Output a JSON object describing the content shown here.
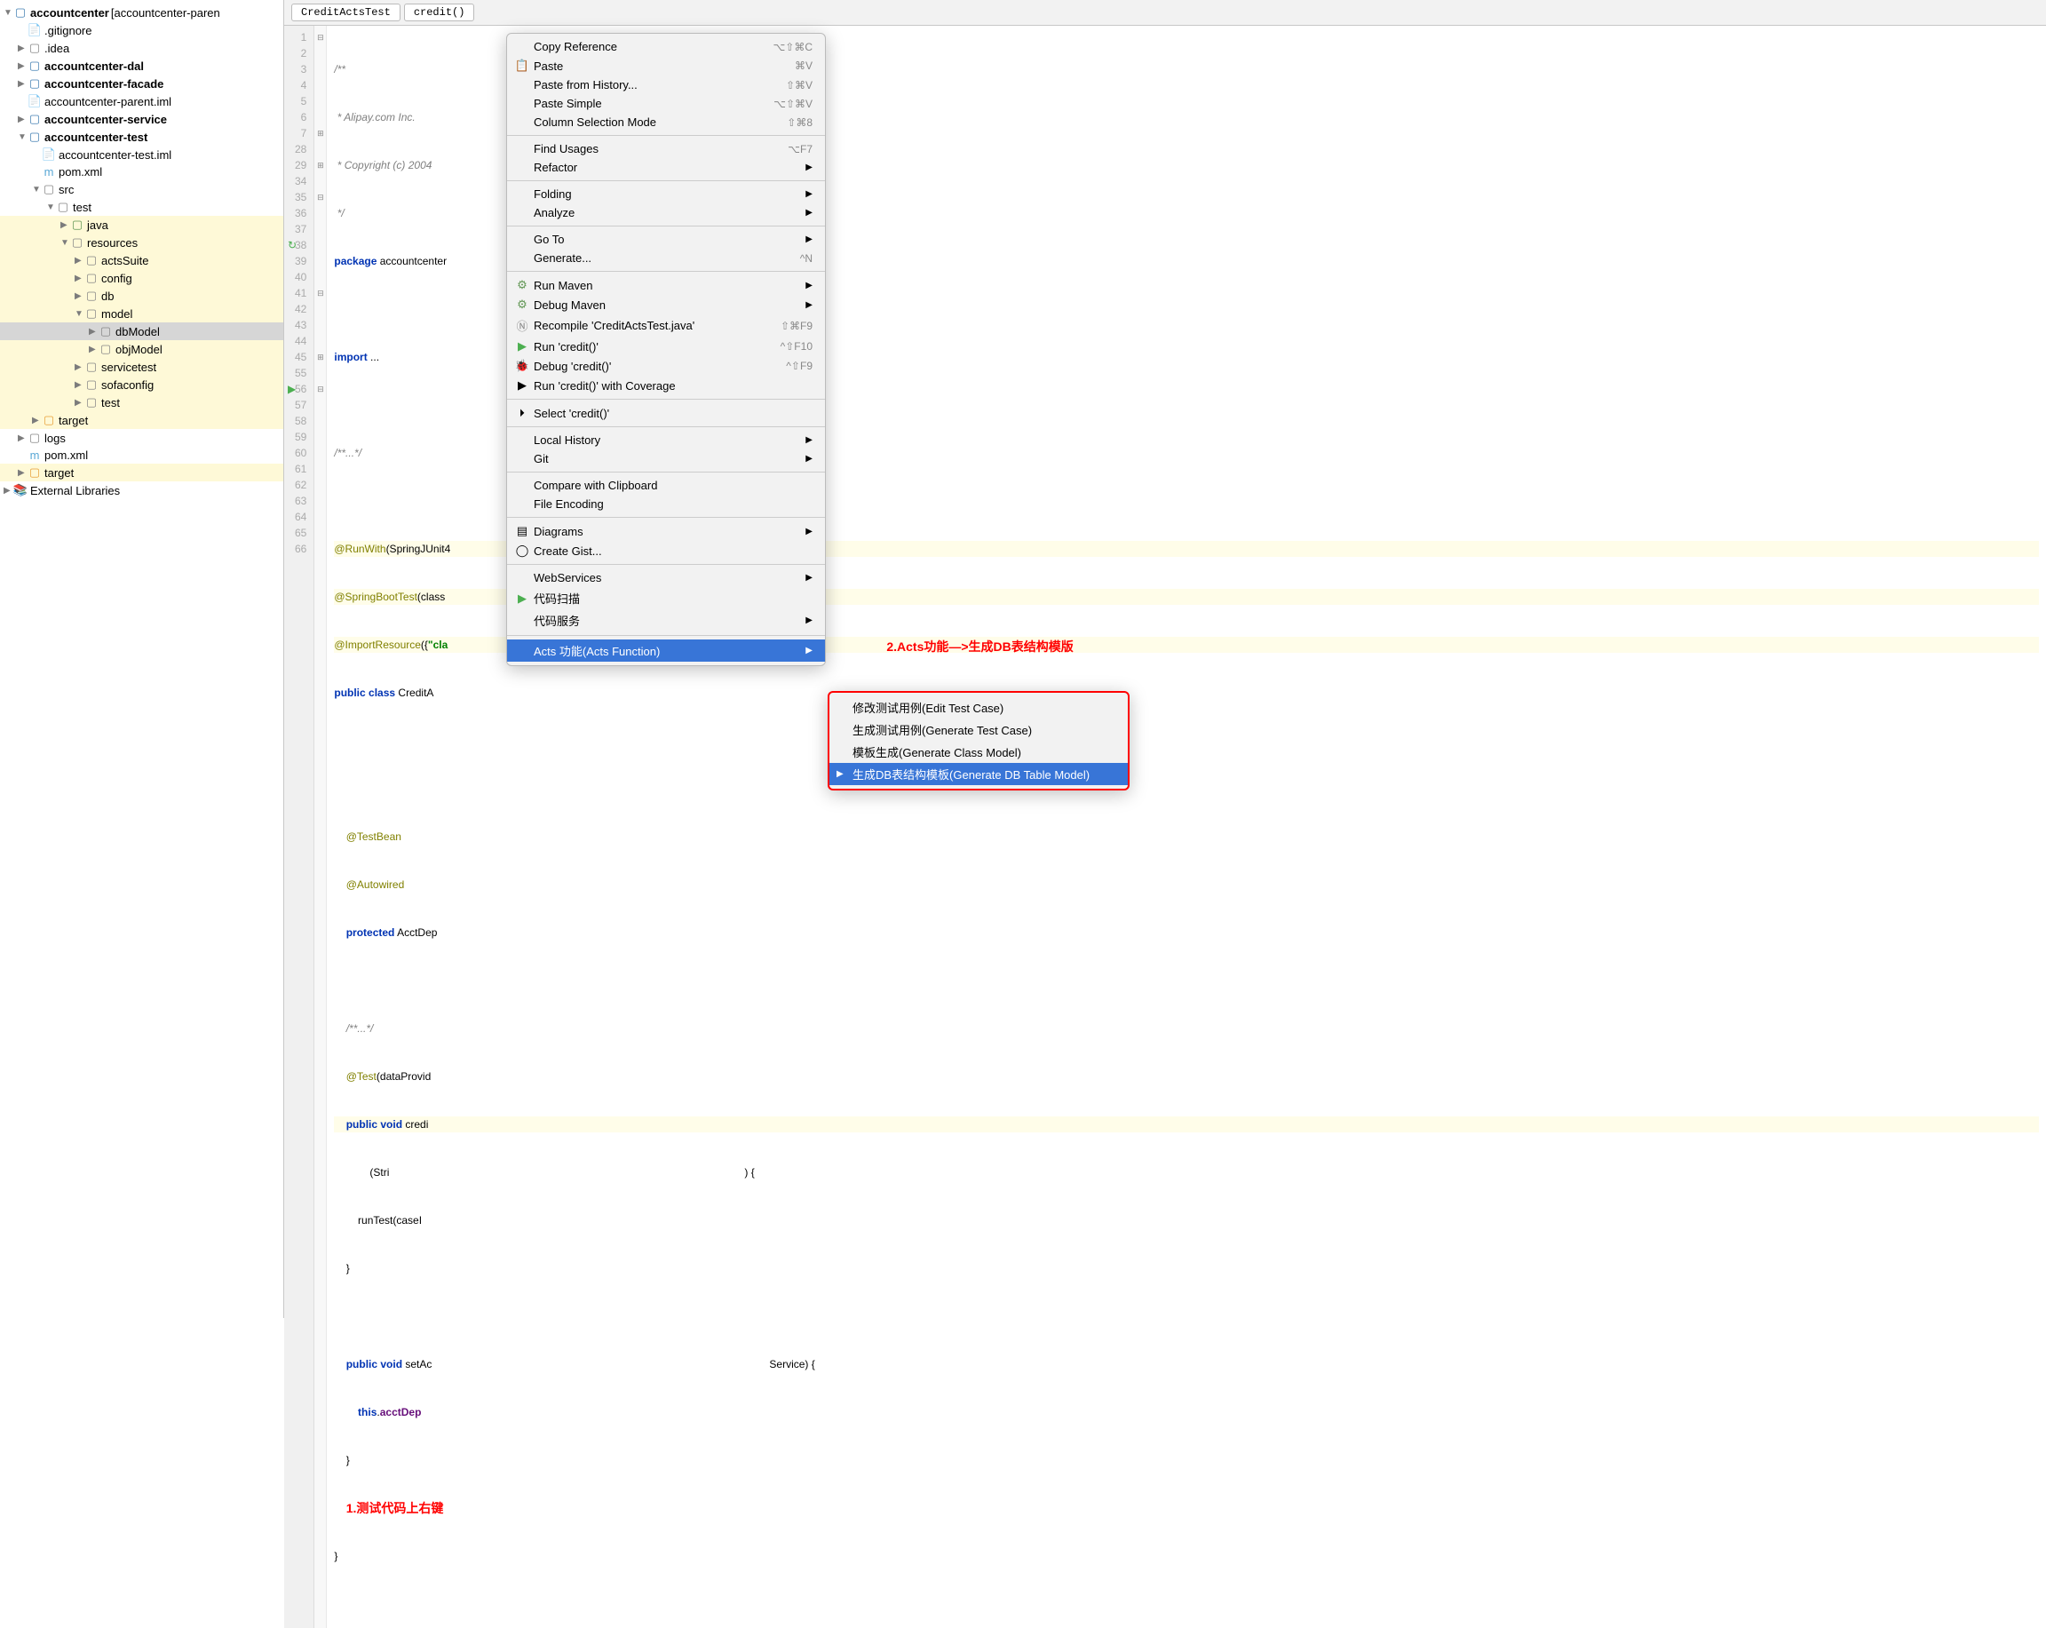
{
  "tree": {
    "root": "accountcenter",
    "root_suffix": " [accountcenter-paren",
    "gitignore": ".gitignore",
    "idea": ".idea",
    "dal": "accountcenter-dal",
    "facade": "accountcenter-facade",
    "parent_iml": "accountcenter-parent.iml",
    "service": "accountcenter-service",
    "test_mod": "accountcenter-test",
    "test_iml": "accountcenter-test.iml",
    "pom1": "pom.xml",
    "src": "src",
    "test": "test",
    "java": "java",
    "resources": "resources",
    "actsSuite": "actsSuite",
    "config": "config",
    "db": "db",
    "model": "model",
    "dbModel": "dbModel",
    "objModel": "objModel",
    "servicetest": "servicetest",
    "sofaconfig": "sofaconfig",
    "test2": "test",
    "target1": "target",
    "logs": "logs",
    "pom2": "pom.xml",
    "target2": "target",
    "extLib": "External Libraries"
  },
  "breadcrumb": {
    "class": "CreditActsTest",
    "method": "credit()"
  },
  "gutter": [
    "1",
    "2",
    "3",
    "4",
    "5",
    "6",
    "7",
    "28",
    "29",
    "34",
    "35",
    "36",
    "37",
    "38",
    "39",
    "40",
    "41",
    "42",
    "43",
    "44",
    "45",
    "55",
    "56",
    "57",
    "58",
    "59",
    "60",
    "61",
    "62",
    "63",
    "64",
    "65",
    "66"
  ],
  "code": {
    "l1": "/**",
    "l2": " * Alipay.com Inc.",
    "l3": " * Copyright (c) 2004",
    "l4": " */",
    "l5_kw": "package",
    "l5_txt": " accountcenter",
    "l7_kw": "import",
    "l7_txt": " ...",
    "l9": "/**...*/",
    "l11": "@RunWith",
    "l11_txt": "(SpringJUnit4",
    "l12": "@SpringBootTest",
    "l12_txt": "(class",
    "l13": "@ImportResource",
    "l13_txt": "({",
    "l13_str": "\"cla",
    "l14_kw": "public class",
    "l14_txt": " CreditA",
    "l17": "@TestBean",
    "l18": "@Autowired",
    "l19_kw": "protected",
    "l19_txt": " AcctDep",
    "l21": "/**...*/",
    "l22": "@Test",
    "l22_txt": "(dataProvid",
    "l23_kw": "public void",
    "l23_txt": " credi",
    "l24": "            (Stri",
    "l25": "        runTest(caseI",
    "l26": "    }",
    "l28_kw": "public void",
    "l28_txt": " setAc",
    "l28_end": "Service) {",
    "l29_kw": "this",
    "l29_txt": ".",
    "l29_id": "acctDep",
    "l30": "    }",
    "l32": "}",
    "l24_end": ") {"
  },
  "menu": {
    "copyRef": "Copy Reference",
    "copyRef_sc": "⌥⇧⌘C",
    "paste": "Paste",
    "paste_sc": "⌘V",
    "pasteHist": "Paste from History...",
    "pasteHist_sc": "⇧⌘V",
    "pasteSimple": "Paste Simple",
    "pasteSimple_sc": "⌥⇧⌘V",
    "colSel": "Column Selection Mode",
    "colSel_sc": "⇧⌘8",
    "findUsages": "Find Usages",
    "findUsages_sc": "⌥F7",
    "refactor": "Refactor",
    "folding": "Folding",
    "analyze": "Analyze",
    "goto": "Go To",
    "generate": "Generate...",
    "generate_sc": "^N",
    "runMaven": "Run Maven",
    "debugMaven": "Debug Maven",
    "recompile": "Recompile 'CreditActsTest.java'",
    "recompile_sc": "⇧⌘F9",
    "run": "Run 'credit()'",
    "run_sc": "^⇧F10",
    "debug": "Debug 'credit()'",
    "debug_sc": "^⇧F9",
    "coverage": "Run 'credit()' with Coverage",
    "select": "Select 'credit()'",
    "localHist": "Local History",
    "git": "Git",
    "compare": "Compare with Clipboard",
    "fileEnc": "File Encoding",
    "diagrams": "Diagrams",
    "gist": "Create Gist...",
    "webServices": "WebServices",
    "codeScan": "代码扫描",
    "codeService": "代码服务",
    "actsFunc": "Acts 功能(Acts Function)"
  },
  "submenu": {
    "editCase": "修改测试用例(Edit Test Case)",
    "genCase": "生成测试用例(Generate Test Case)",
    "genClass": "模板生成(Generate Class Model)",
    "genDb": "生成DB表结构模板(Generate DB Table Model)"
  },
  "annotations": {
    "a1": "1.测试代码上右键",
    "a2": "2.Acts功能—>生成DB表结构模版"
  }
}
